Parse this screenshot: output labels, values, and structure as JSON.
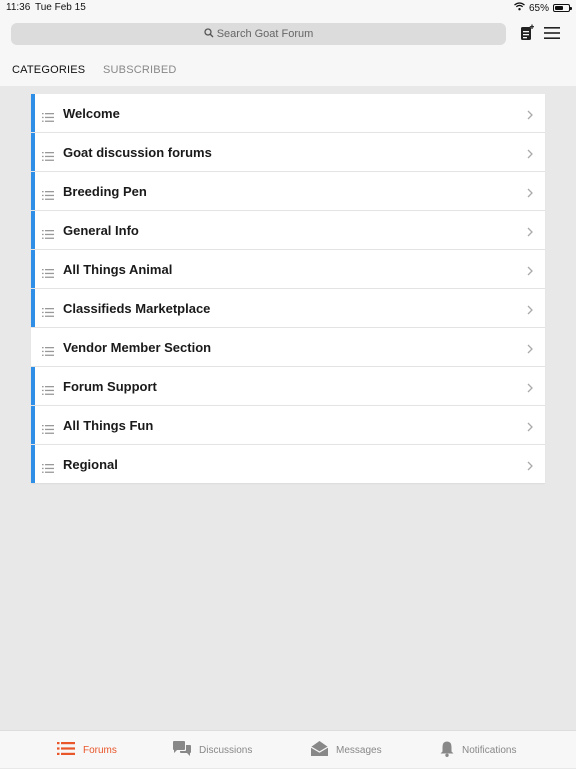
{
  "status": {
    "time": "11:36",
    "date": "Tue Feb 15",
    "battery": "65%",
    "battery_level": 0.65
  },
  "search": {
    "placeholder": "Search Goat Forum",
    "icon": "search-icon"
  },
  "toolbar": {
    "compose_icon": "compose-icon",
    "menu_icon": "hamburger-menu-icon"
  },
  "tabs": [
    {
      "label": "CATEGORIES",
      "active": true
    },
    {
      "label": "SUBSCRIBED",
      "active": false
    }
  ],
  "categories": [
    {
      "label": "Welcome",
      "accent": "#2f8fe6"
    },
    {
      "label": "Goat discussion forums",
      "accent": "#2f8fe6"
    },
    {
      "label": "Breeding Pen",
      "accent": "#2f8fe6"
    },
    {
      "label": "General Info",
      "accent": "#2f8fe6"
    },
    {
      "label": "All Things Animal",
      "accent": "#2f8fe6"
    },
    {
      "label": "Classifieds Marketplace",
      "accent": "#2f8fe6"
    },
    {
      "label": "Vendor Member Section",
      "accent": "#ffffff"
    },
    {
      "label": "Forum Support",
      "accent": "#2f8fe6"
    },
    {
      "label": "All Things Fun",
      "accent": "#2f8fe6"
    },
    {
      "label": "Regional",
      "accent": "#2f8fe6"
    }
  ],
  "bottom_nav": [
    {
      "label": "Forums",
      "icon": "forums-list-icon",
      "active": true
    },
    {
      "label": "Discussions",
      "icon": "chat-bubbles-icon",
      "active": false
    },
    {
      "label": "Messages",
      "icon": "envelope-icon",
      "active": false
    },
    {
      "label": "Notifications",
      "icon": "bell-icon",
      "active": false
    }
  ],
  "colors": {
    "accent": "#e8562a",
    "category_bar": "#2f8fe6"
  }
}
